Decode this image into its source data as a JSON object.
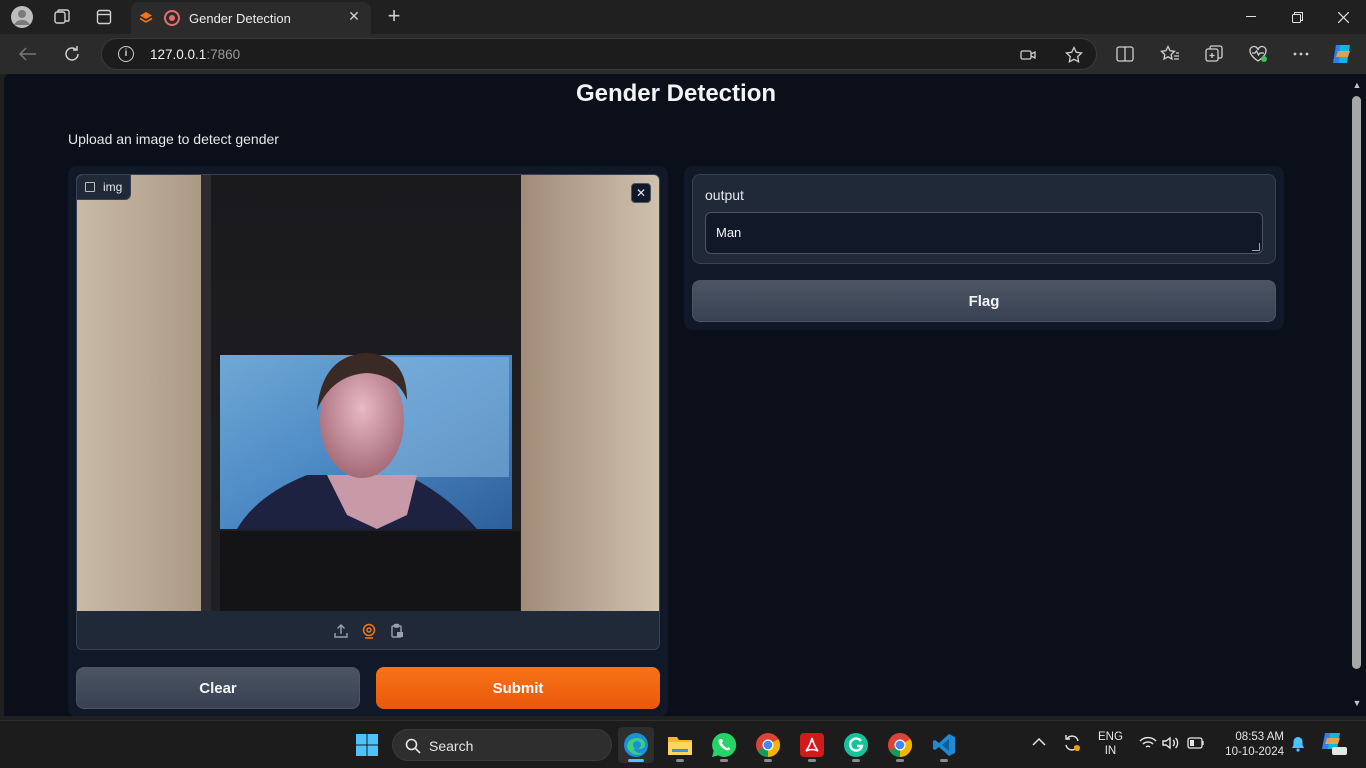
{
  "browser": {
    "tab_title": "Gender Detection",
    "url_host": "127.0.0.1",
    "url_port": ":7860"
  },
  "page": {
    "title": "Gender Detection",
    "description": "Upload an image to detect gender",
    "input": {
      "label": "img"
    },
    "buttons": {
      "clear": "Clear",
      "submit": "Submit",
      "flag": "Flag"
    },
    "output": {
      "label": "output",
      "value": "Man"
    }
  },
  "taskbar": {
    "search_label": "Search",
    "lang_top": "ENG",
    "lang_bottom": "IN",
    "time": "08:53 AM",
    "date": "10-10-2024",
    "apps": [
      "edge-icon",
      "file-explorer-icon",
      "whatsapp-icon",
      "chrome-icon",
      "acrobat-icon",
      "grammarly-icon",
      "chrome-icon",
      "vscode-icon"
    ]
  },
  "colors": {
    "accent": "#f97316",
    "page_bg": "#0b0f19",
    "panel_bg": "#111827",
    "block_bg": "#1f2937"
  }
}
